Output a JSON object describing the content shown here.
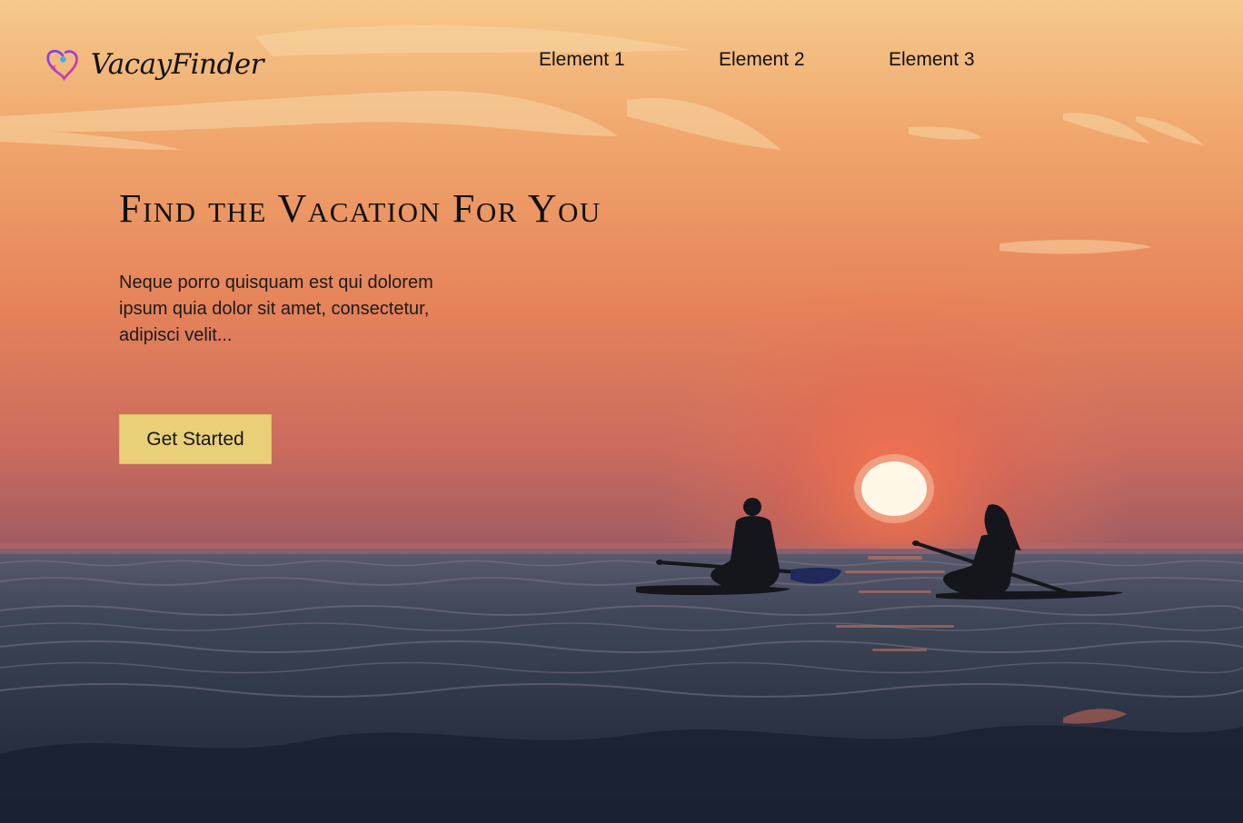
{
  "brand": {
    "name": "VacayFinder",
    "colors": {
      "heart_gradient_start": "#7b3ff0",
      "heart_gradient_end": "#e0409a",
      "accent_dot": "#3bb0f0"
    }
  },
  "nav": {
    "items": [
      {
        "label": "Element 1"
      },
      {
        "label": "Element 2"
      },
      {
        "label": "Element 3"
      }
    ]
  },
  "hero": {
    "title": "Find the Vacation For You",
    "description": "Neque porro quisquam est qui dolorem ipsum quia dolor sit amet, consectetur, adipisci velit...",
    "cta_label": "Get Started",
    "cta_color": "#e9cf78",
    "background": "sunset-sea-paddleboarders"
  }
}
